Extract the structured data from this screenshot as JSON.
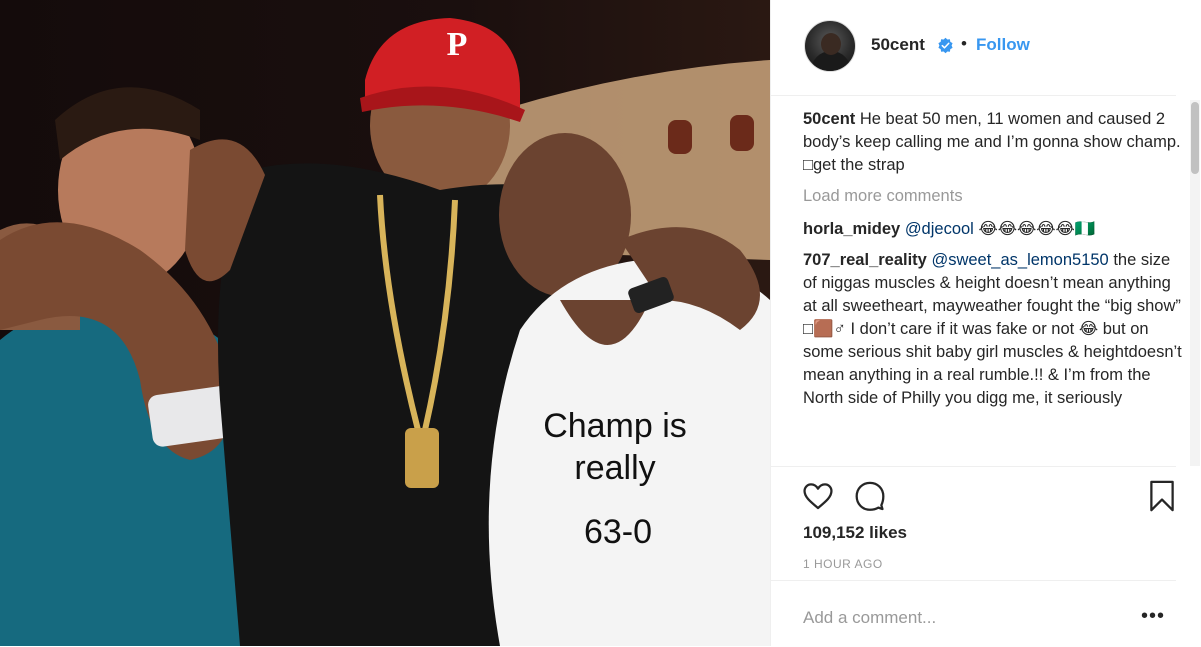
{
  "post": {
    "author": "50cent",
    "follow_label": "Follow",
    "separator": "•",
    "shirt_text": {
      "line1": "Champ is",
      "line2": "really",
      "line3": "63-0"
    }
  },
  "comments": {
    "caption": {
      "user": "50cent",
      "text": "He beat 50 men, 11 women and caused 2 body’s keep calling me and I’m gonna show champ. □get the strap"
    },
    "load_more_label": "Load more comments",
    "items": [
      {
        "user": "horla_midey",
        "mention": "@djecool",
        "text": " 😂😂😂😂😂🇳🇬"
      },
      {
        "user": "707_real_reality",
        "mention": "@sweet_as_lemon5150",
        "text": " the size of niggas muscles & height doesn’t mean anything at all sweetheart, mayweather fought the “big show” □🟫♂ I don’t care if it was fake or not 😂 but on some serious shit baby girl muscles & heightdoesn’t mean anything in a real rumble.!! & I’m from the North side of Philly you digg me, it seriously"
      }
    ]
  },
  "actions": {
    "likes_label": "109,152 likes",
    "timestamp": "1 HOUR AGO"
  },
  "comment_box": {
    "placeholder": "Add a comment...",
    "more_label": "•••"
  },
  "icons": {
    "like": "heart-icon",
    "comment": "comment-bubble-icon",
    "save": "bookmark-icon",
    "verified": "verified-badge-icon",
    "more": "more-options-icon"
  },
  "colors": {
    "link": "#3897f0",
    "text": "#262626",
    "muted": "#999999",
    "border": "#efefef",
    "mention": "#003569"
  }
}
